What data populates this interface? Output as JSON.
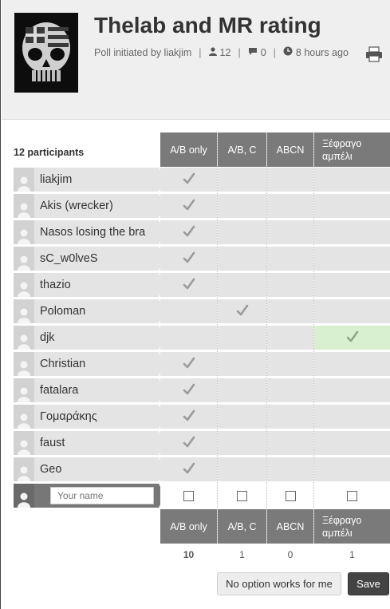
{
  "poll": {
    "title": "Thelab and MR rating",
    "initiated_by": "Poll initiated by liakjim",
    "participant_count": "12",
    "comment_count": "0",
    "time_ago": "8 hours ago",
    "participants_label": "12 participants"
  },
  "icons": {
    "avatar": "skull-flag-avatar",
    "user": "user-icon",
    "comment": "comment-icon",
    "clock": "clock-icon",
    "print": "printer-icon",
    "check": "checkmark-icon"
  },
  "columns": [
    {
      "label": "A/B only",
      "count": "10"
    },
    {
      "label": "A/B, C",
      "count": "1"
    },
    {
      "label": "ABCN",
      "count": "0"
    },
    {
      "label": "Ξέφραγο\nαμπέλι",
      "count": "1"
    }
  ],
  "participants": [
    {
      "name": "liakjim",
      "votes": [
        true,
        false,
        false,
        false
      ]
    },
    {
      "name": "Akis (wrecker)",
      "votes": [
        true,
        false,
        false,
        false
      ]
    },
    {
      "name": "Nasos losing the bra",
      "votes": [
        true,
        false,
        false,
        false
      ]
    },
    {
      "name": "sC_w0lveS",
      "votes": [
        true,
        false,
        false,
        false
      ]
    },
    {
      "name": "thazio",
      "votes": [
        true,
        false,
        false,
        false
      ]
    },
    {
      "name": "Poloman",
      "votes": [
        false,
        true,
        false,
        false
      ]
    },
    {
      "name": "djk",
      "votes": [
        false,
        false,
        false,
        true
      ]
    },
    {
      "name": "Christian",
      "votes": [
        true,
        false,
        false,
        false
      ]
    },
    {
      "name": "fatalara",
      "votes": [
        true,
        false,
        false,
        false
      ]
    },
    {
      "name": "Γομαράκης",
      "votes": [
        true,
        false,
        false,
        false
      ]
    },
    {
      "name": "faust",
      "votes": [
        true,
        false,
        false,
        false
      ]
    },
    {
      "name": "Geo",
      "votes": [
        true,
        false,
        false,
        false
      ]
    }
  ],
  "new_entry": {
    "name_placeholder": "Your name",
    "name_value": ""
  },
  "actions": {
    "no_option_label": "No option works for me",
    "save_label": "Save"
  },
  "colors": {
    "header_bg": "#efefef",
    "column_header_bg": "#7a7a7a",
    "cell_bg": "#e4e4e4",
    "highlight_cell_bg": "#d8f0cf",
    "save_button_bg": "#444444"
  }
}
